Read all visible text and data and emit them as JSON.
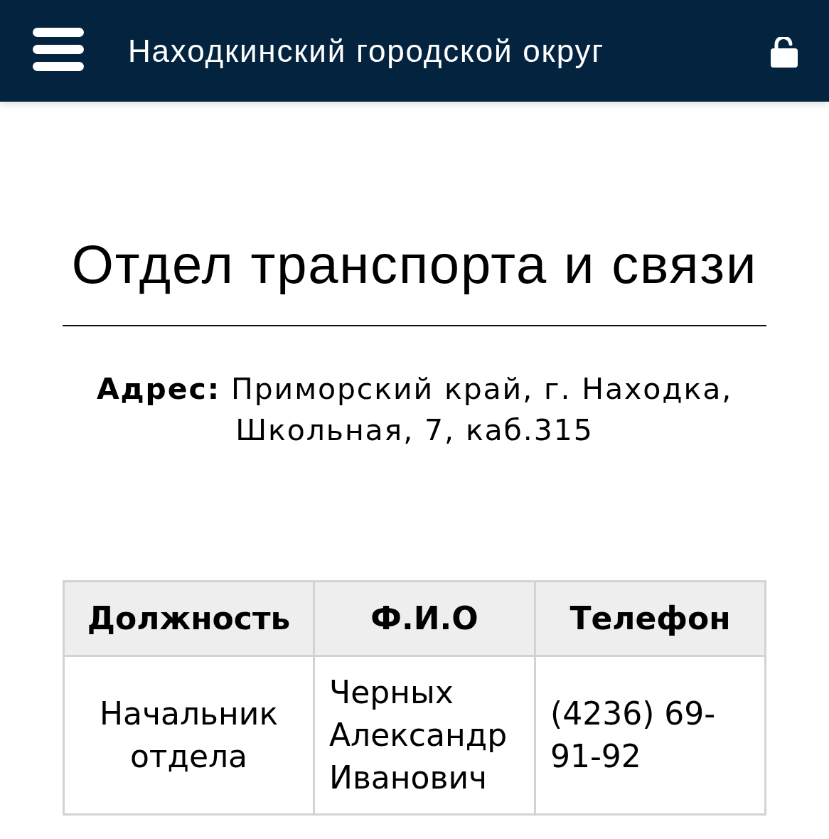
{
  "header": {
    "title": "Находкинский городской округ"
  },
  "page": {
    "title": "Отдел транспорта и связи",
    "address": "**Адрес:** Приморский край, г. Находка, Школьная, 7, каб.315"
  },
  "table": {
    "columns": [
      "Должность",
      "Ф.И.О",
      "Телефон"
    ],
    "rows": [
      [
        "Начальник отдела",
        "Черных Александр Иванович",
        "(4236) 69-91-92"
      ]
    ]
  }
}
